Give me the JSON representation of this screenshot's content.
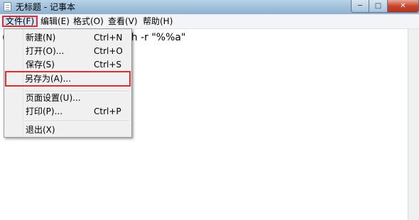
{
  "window": {
    "title": "无标题 - 记事本",
    "icon": "notepad-icon"
  },
  "menubar": [
    "文件(F)",
    "编辑(E)",
    "格式(O)",
    "查看(V)",
    "帮助(H)"
  ],
  "editor": {
    "text": "('dir /a /b') do attrib -a -s -h -r \"%%a\""
  },
  "file_menu": {
    "items": [
      {
        "label": "新建(N)",
        "shortcut": "Ctrl+N"
      },
      {
        "label": "打开(O)...",
        "shortcut": "Ctrl+O"
      },
      {
        "label": "保存(S)",
        "shortcut": "Ctrl+S"
      },
      {
        "label": "另存为(A)...",
        "shortcut": ""
      },
      {
        "label": "页面设置(U)...",
        "shortcut": ""
      },
      {
        "label": "打印(P)...",
        "shortcut": "Ctrl+P"
      },
      {
        "label": "退出(X)",
        "shortcut": ""
      }
    ]
  },
  "highlight_color": "#e52b2b"
}
